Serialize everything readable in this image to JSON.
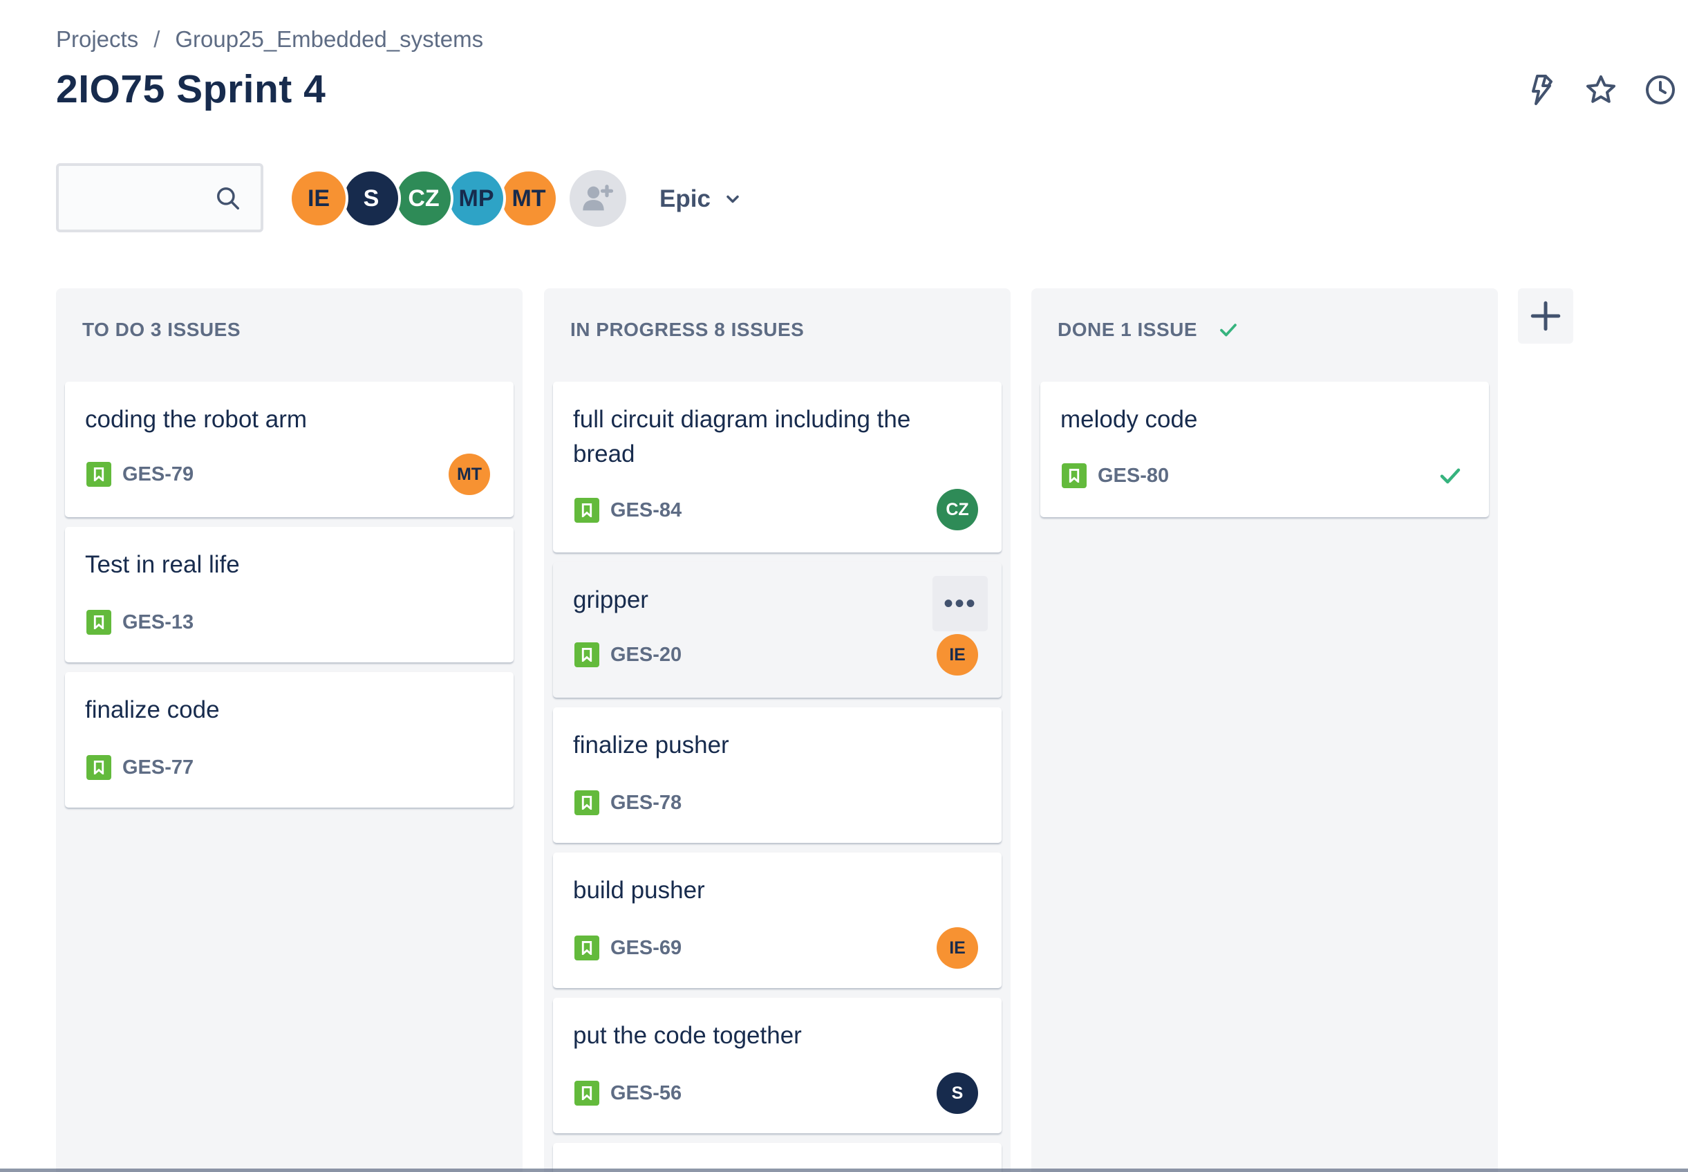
{
  "breadcrumb": {
    "root": "Projects",
    "separator": "/",
    "project": "Group25_Embedded_systems"
  },
  "page": {
    "title": "2IO75 Sprint 4"
  },
  "header_actions": [
    "lightning-icon",
    "star-icon",
    "clock-icon"
  ],
  "search": {
    "value": "",
    "placeholder": ""
  },
  "avatars": [
    {
      "initials": "IE",
      "bg": "#f79232",
      "fg": "#172b4d"
    },
    {
      "initials": "S",
      "bg": "#172b4d",
      "fg": "#ffffff"
    },
    {
      "initials": "CZ",
      "bg": "#36b37e",
      "fg": "#ffffff"
    },
    {
      "initials": "MP",
      "bg": "#2ea3c6",
      "fg": "#172b4d"
    },
    {
      "initials": "MT",
      "bg": "#f79232",
      "fg": "#172b4d"
    }
  ],
  "epic_filter": {
    "label": "Epic"
  },
  "columns": [
    {
      "header": "TO DO 3 ISSUES",
      "cards": [
        {
          "title": "coding the robot arm",
          "key": "GES-79",
          "assignee": "MT"
        },
        {
          "title": "Test in real life",
          "key": "GES-13",
          "assignee": ""
        },
        {
          "title": "finalize code",
          "key": "GES-77",
          "assignee": ""
        }
      ]
    },
    {
      "header": "IN PROGRESS 8 ISSUES",
      "cards": [
        {
          "title": "full circuit diagram including the bread",
          "key": "GES-84",
          "assignee": "CZ"
        },
        {
          "title": "gripper",
          "key": "GES-20",
          "assignee": "IE",
          "more": "•••"
        },
        {
          "title": "finalize pusher",
          "key": "GES-78",
          "assignee": ""
        },
        {
          "title": "build pusher",
          "key": "GES-69",
          "assignee": "IE"
        },
        {
          "title": "put the code together",
          "key": "GES-56",
          "assignee": "S"
        }
      ]
    },
    {
      "header": "DONE 1 ISSUE",
      "cards": [
        {
          "title": "melody code",
          "key": "GES-80",
          "assignee": ""
        }
      ]
    }
  ],
  "colors": {
    "story": "#63ba3c",
    "done_check": "#36b37e",
    "text": "#172b4d",
    "muted": "#5e6c84"
  }
}
